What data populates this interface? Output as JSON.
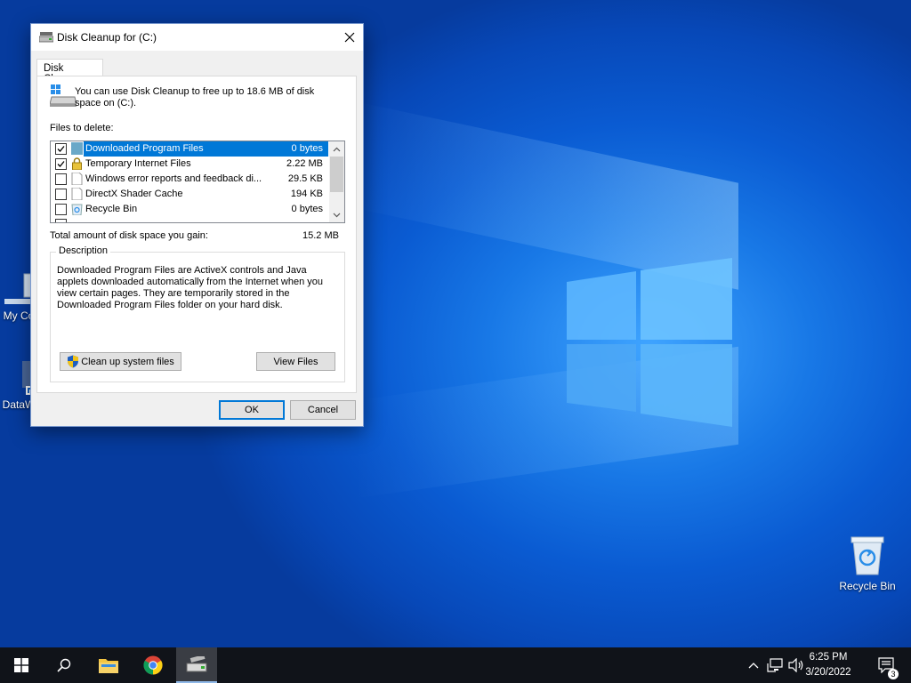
{
  "window": {
    "title": "Disk Cleanup for  (C:)",
    "tab_label": "Disk Cleanup",
    "intro_text": "You can use Disk Cleanup to free up to 18.6 MB of disk space on  (C:).",
    "files_to_delete_label": "Files to delete:",
    "files": [
      {
        "name": "Downloaded Program Files",
        "size": "0 bytes",
        "checked": true,
        "selected": true
      },
      {
        "name": "Temporary Internet Files",
        "size": "2.22 MB",
        "checked": true,
        "selected": false
      },
      {
        "name": "Windows error reports and feedback di...",
        "size": "29.5 KB",
        "checked": false,
        "selected": false
      },
      {
        "name": "DirectX Shader Cache",
        "size": "194 KB",
        "checked": false,
        "selected": false
      },
      {
        "name": "Recycle Bin",
        "size": "0 bytes",
        "checked": false,
        "selected": false
      }
    ],
    "total_label": "Total amount of disk space you gain:",
    "total_value": "15.2 MB",
    "description_legend": "Description",
    "description_text": "Downloaded Program Files are ActiveX controls and Java applets downloaded automatically from the Internet when you view certain pages. They are temporarily stored in the Downloaded Program Files folder on your hard disk.",
    "cleanup_system_button": "Clean up system files",
    "view_files_button": "View Files",
    "ok_button": "OK",
    "cancel_button": "Cancel"
  },
  "desktop": {
    "icons": [
      {
        "label": "My Co",
        "icon": "computer-icon"
      },
      {
        "label": "DataW",
        "icon": "shortcut-icon"
      },
      {
        "label": "Recycle Bin",
        "icon": "recycle-bin-icon"
      }
    ]
  },
  "taskbar": {
    "time": "6:25 PM",
    "date": "3/20/2022",
    "notification_count": "3"
  },
  "colors": {
    "accent": "#0078d7",
    "desktop_blue": "#0a5bd2",
    "taskbar": "#101319"
  }
}
